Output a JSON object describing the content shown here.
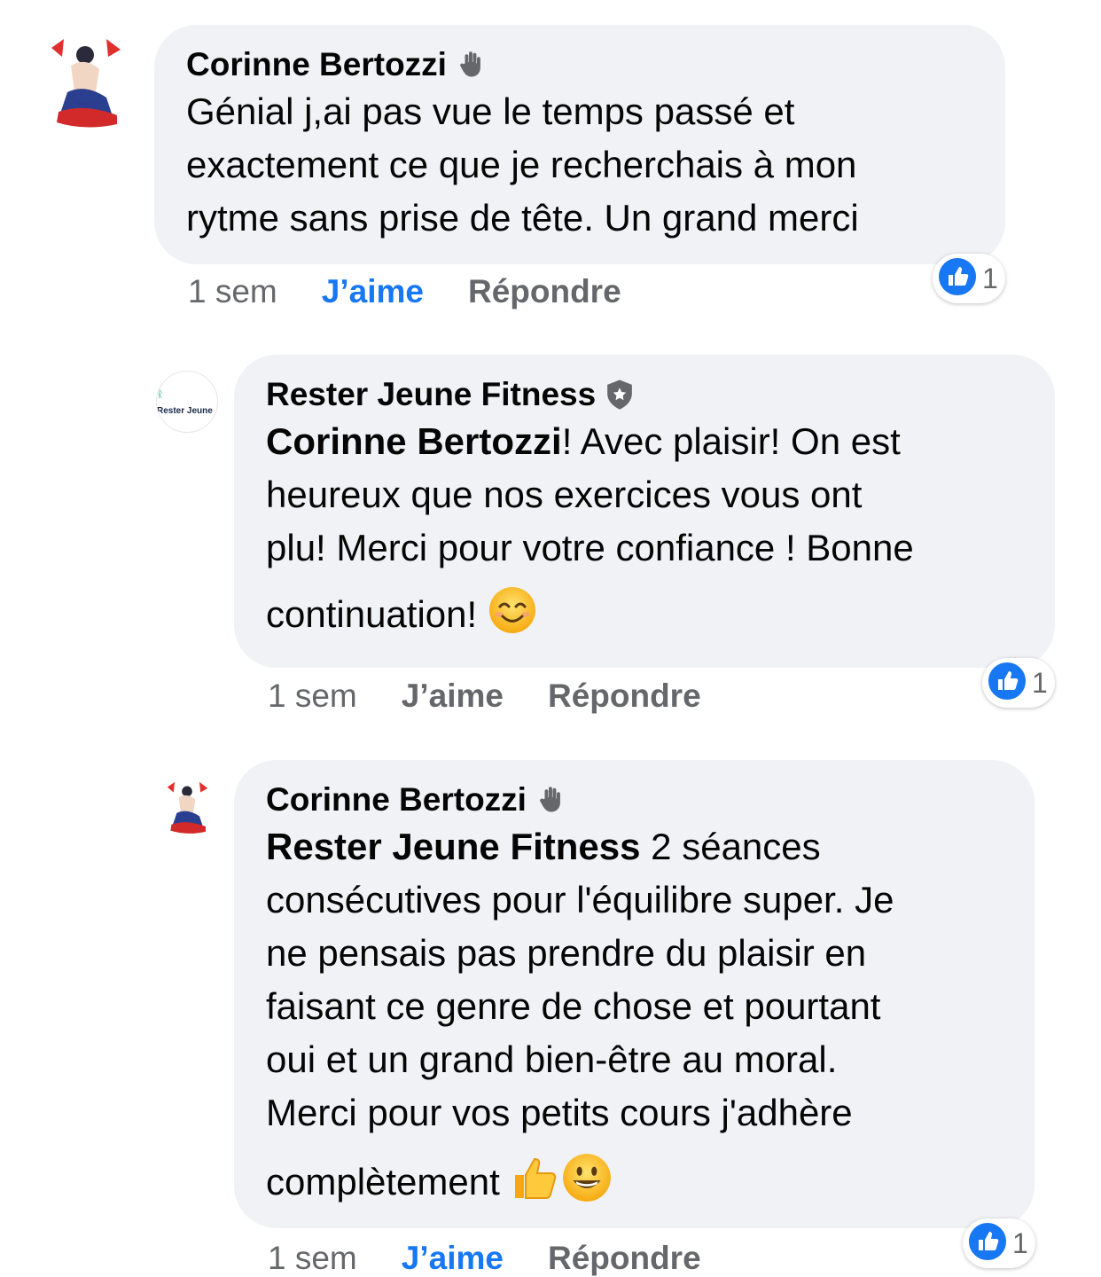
{
  "comments": [
    {
      "author": "Corinne Bertozzi",
      "author_badge_icon": "waving-hand-icon",
      "lines": [
        "Génial j,ai pas vue le temps passé et",
        "exactement ce que je recherchais à mon",
        "rytme sans prise de tête. Un grand merci"
      ],
      "time": "1 sem",
      "like_label": "J’aime",
      "reply_label": "Répondre",
      "reaction_count": "1"
    },
    {
      "author": "Rester Jeune Fitness",
      "author_badge_icon": "shield-star-icon",
      "mention": "Corinne Bertozzi",
      "mention_suffix": "! Avec plaisir! On est",
      "lines": [
        "heureux que nos exercices vous ont",
        "plu! Merci pour votre confiance ! Bonne",
        "continuation!"
      ],
      "time": "1 sem",
      "like_label": "J’aime",
      "reply_label": "Répondre",
      "reaction_count": "1"
    },
    {
      "author": "Corinne Bertozzi",
      "author_badge_icon": "waving-hand-icon",
      "mention": "Rester Jeune Fitness",
      "mention_suffix": " 2 séances",
      "lines": [
        "consécutives pour l'équilibre super. Je",
        "ne pensais pas prendre du plaisir en",
        "faisant ce genre de chose et pourtant",
        "oui et un grand bien-être au moral.",
        "Merci pour vos petits cours j'adhère",
        "complètement"
      ],
      "time": "1 sem",
      "like_label": "J’aime",
      "reply_label": "Répondre",
      "reaction_count": "1"
    }
  ],
  "brand_logo_text": "Rester Jeune",
  "colors": {
    "bubble": "#f0f2f5",
    "like_active": "#1877f2",
    "meta_text": "#65676b"
  }
}
